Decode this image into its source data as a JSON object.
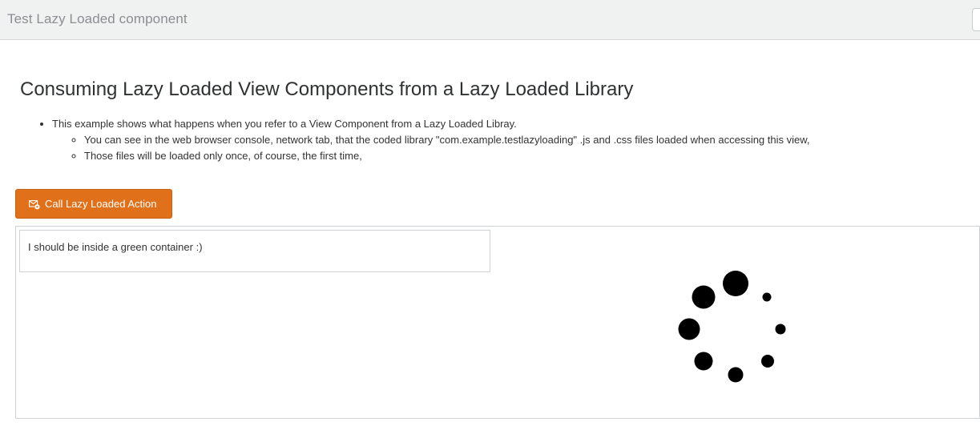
{
  "header": {
    "title": "Test Lazy Loaded component"
  },
  "main": {
    "heading": "Consuming Lazy Loaded View Components from a Lazy Loaded Library",
    "bullets": [
      {
        "text": "This example shows what happens when you refer to a View Component from a Lazy Loaded Libray.",
        "subitems": [
          "You can see in the web browser console, network tab, that the coded library \"com.example.testlazyloading\" .js and .css files loaded when accessing this view,",
          "Those files will be loaded only once, of course, the first time,"
        ]
      }
    ],
    "action_button": {
      "label": "Call Lazy Loaded Action",
      "icon": "envelope-gear-icon"
    },
    "component_text": "I should be inside a green container :)",
    "loading_indicator": {
      "icon": "loading-spinner-icon"
    }
  },
  "colors": {
    "header_bg": "#f0f1f1",
    "header_text": "#8a8f94",
    "button_bg": "#e0701a",
    "button_text": "#ffffff",
    "border": "#cfd3d5",
    "spinner": "#000000"
  }
}
